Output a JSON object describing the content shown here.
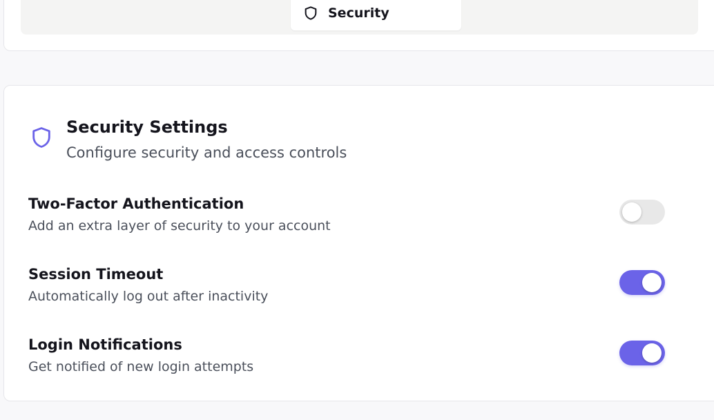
{
  "tabs": {
    "active_tab": {
      "label": "Security",
      "icon": "shield-icon"
    }
  },
  "security_card": {
    "icon": "shield-icon",
    "accent_color": "#6b63e8",
    "title": "Security Settings",
    "subtitle": "Configure security and access controls",
    "settings": [
      {
        "title": "Two-Factor Authentication",
        "description": "Add an extra layer of security to your account",
        "enabled": false
      },
      {
        "title": "Session Timeout",
        "description": "Automatically log out after inactivity",
        "enabled": true
      },
      {
        "title": "Login Notifications",
        "description": "Get notified of new login attempts",
        "enabled": true
      }
    ]
  }
}
